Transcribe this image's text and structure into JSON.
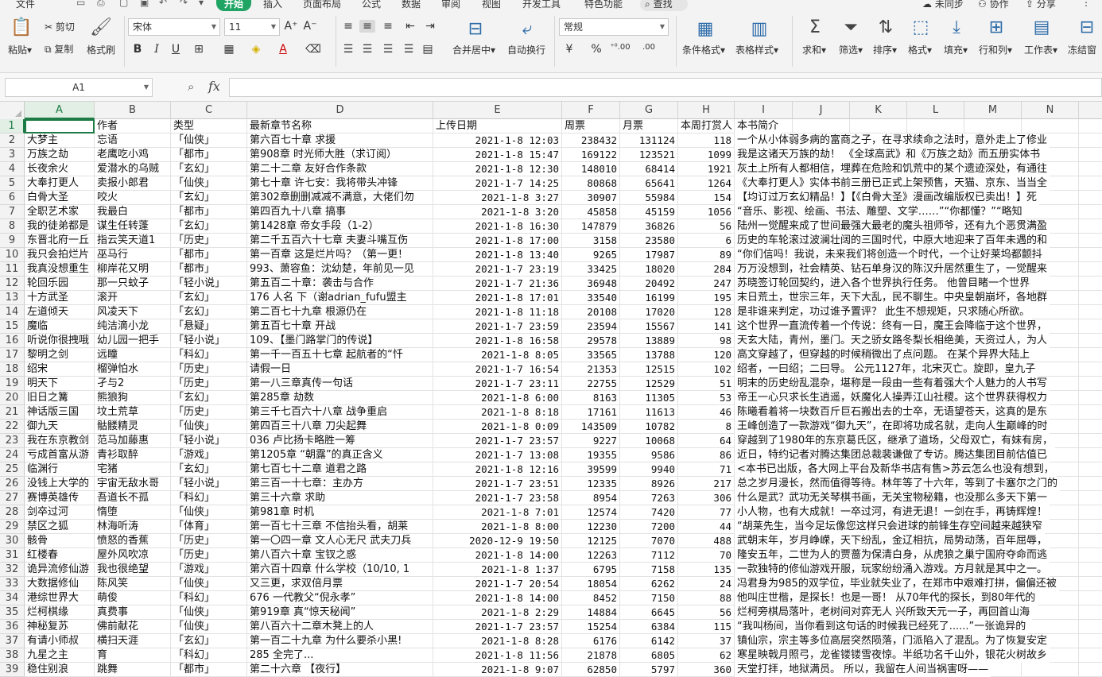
{
  "menubar": {
    "file": "文件",
    "tabs": [
      "开始",
      "插入",
      "页面布局",
      "公式",
      "数据",
      "审阅",
      "视图",
      "开发工具",
      "特色功能"
    ],
    "search": "查找",
    "right": [
      "未同步",
      "协作",
      "分享"
    ]
  },
  "ribbon": {
    "paste": "粘贴",
    "cut": "剪切",
    "copy": "复制",
    "format_painter": "格式刷",
    "font_name": "宋体",
    "font_size": "11",
    "merge_center": "合并居中",
    "wrap_text": "自动换行",
    "number_format": "常规",
    "currency": "¥",
    "percent": "%",
    "inc_decimal": "⁺⁰.00",
    "dec_decimal": ".00",
    "cond_format": "条件格式",
    "table_style": "表格样式",
    "sum": "求和",
    "filter": "筛选",
    "sort": "排序",
    "format": "格式",
    "fill": "填充",
    "row_col": "行和列",
    "worksheet": "工作表",
    "freeze": "冻结窗"
  },
  "formula": {
    "name_box": "A1",
    "value": ""
  },
  "grid": {
    "columns": [
      "A",
      "B",
      "C",
      "D",
      "E",
      "F",
      "G",
      "H",
      "I",
      "J",
      "K",
      "L",
      "M",
      "N"
    ],
    "rows": [
      [
        "",
        "作者",
        "类型",
        "最新章节名称",
        "上传日期",
        "周票",
        "月票",
        "本周打赏人",
        "本书简介"
      ],
      [
        "大梦主",
        "忘语",
        "「仙侠」",
        "第六百七十章 求援",
        "2021-1-8 12:03",
        "238432",
        "131124",
        "118",
        "一个从小体弱多病的富商之子，在寻求续命之法时，意外走上了修业"
      ],
      [
        "万族之劫",
        "老鹰吃小鸡",
        "「都市」",
        "第908章 时光师大胜（求订阅）",
        "2021-1-8 15:47",
        "169122",
        "123521",
        "1099",
        "我是这诸天万族的劫！  《全球高武》和《万族之劫》而五册实体书"
      ],
      [
        "长夜余火",
        "爱潜水的乌贼",
        "「玄幻」",
        "第二十二章 友好合作条款",
        "2021-1-8 12:30",
        "148010",
        "68414",
        "1921",
        "灰土上所有人都相信，埋葬在危险和饥荒中的某个遗迹深处，有通往"
      ],
      [
        "大奉打更人",
        "卖报小郎君",
        "「仙侠」",
        "第七十章 许七安：我将带头冲锋",
        "2021-1-7 14:25",
        "80868",
        "65641",
        "1264",
        "《大奉打更人》实体书前三册已正式上架预售，天猫、京东、当当全"
      ],
      [
        "白骨大圣",
        "咬火",
        "「玄幻」",
        "第302章删删减减不满意，大佬们勿",
        "2021-1-8 3:27",
        "30907",
        "55984",
        "154",
        "【均订过万玄幻精品！】【《白骨大圣》漫画改编版权已卖出！】死"
      ],
      [
        "全职艺术家",
        "我最白",
        "「都市」",
        "第四百九十八章 搞事",
        "2021-1-8 3:20",
        "45858",
        "45159",
        "1056",
        "“音乐、影视、绘画、书法、雕塑、文学……”“你都懂？”“略知"
      ],
      [
        "我的徒弟都是",
        "谋生任转蓬",
        "「玄幻」",
        "第1428章 帝女手段（1-2）",
        "2021-1-8 16:30",
        "147879",
        "36826",
        "56",
        "陆州一觉醒来成了世间最强大最老的魔头祖师爷，还有九个恶贯满盈"
      ],
      [
        "东晋北府一丘",
        "指云笑天道1",
        "「历史」",
        "第二千五百六十七章 夫妻斗嘴互伤",
        "2021-1-8 17:00",
        "3158",
        "23580",
        "6",
        "历史的车轮滚过波澜壮阔的三国时代，中原大地迎来了百年未遇的和"
      ],
      [
        "我只会拍烂片",
        "巫马行",
        "「都市」",
        "第一百章 这是烂片吗？（第一更！",
        "2021-1-8 13:40",
        "9265",
        "17987",
        "89",
        "“你们信吗！我说，未来我们将创造一个时代，一个让好莱坞都颤抖"
      ],
      [
        "我真没想重生",
        "柳岸花又明",
        "「都市」",
        "993、萧容鱼：沈幼楚，年前见一见",
        "2021-1-7 23:19",
        "33425",
        "18020",
        "284",
        "万万没想到，社会精英、钻石单身汉的陈汉升居然重生了，一觉醒来"
      ],
      [
        "轮回乐园",
        "那一只蚊子",
        "「轻小说」",
        "第五百二十章：袭击与合作",
        "2021-1-7 21:36",
        "36948",
        "20492",
        "247",
        "苏晓签订轮回契约，进入各个世界执行任务。  他曾目睹一个世界"
      ],
      [
        "十方武圣",
        "滚开",
        "「玄幻」",
        "176 人名 下（谢adrian_fufu盟主",
        "2021-1-8 17:01",
        "33540",
        "16199",
        "195",
        "末日荒土，世宗三年，天下大乱，民不聊生。中央皇朝崩坏，各地群"
      ],
      [
        "左道倾天",
        "风凌天下",
        "「玄幻」",
        "第二百七十九章 根源仍在",
        "2021-1-8 11:18",
        "20108",
        "17020",
        "128",
        "是非谁来判定，功过谁予置评？  此生不想规矩，只求随心所欲。"
      ],
      [
        "魔临",
        "纯洁滴小龙",
        "「悬疑」",
        "第五百七十章 开战",
        "2021-1-7 23:59",
        "23594",
        "15567",
        "141",
        "这个世界一直流传着一个传说：终有一日，魔王会降临于这个世界，"
      ],
      [
        "听说你很拽哦",
        "幼儿园一把手",
        "「轻小说」",
        "109、【墨门路掌门的传说】",
        "2021-1-8 16:58",
        "29578",
        "13889",
        "98",
        "天玄大陆，青州，墨门。天之骄女路冬梨长相绝美，天资过人，为人"
      ],
      [
        "黎明之剑",
        "远瞳",
        "「科幻」",
        "第一千一百五十七章 起航者的“忏",
        "2021-1-8 8:05",
        "33565",
        "13788",
        "120",
        "高文穿越了，但穿越的时候稍微出了点问题。  在某个异界大陆上"
      ],
      [
        "绍宋",
        "榴弹怕水",
        "「历史」",
        "请假一日",
        "2021-1-7 16:54",
        "21353",
        "12515",
        "102",
        "绍者，一曰绍；二曰导。  公元1127年，北宋灭亡。旋即，皇九子"
      ],
      [
        "明天下",
        "孑与2",
        "「历史」",
        "第一八三章真传一句话",
        "2021-1-7 23:11",
        "22755",
        "12529",
        "51",
        "明末的历史纷乱混杂，堪称是一段由一些有着强大个人魅力的人书写"
      ],
      [
        "旧日之篝",
        "熊狼狗",
        "「玄幻」",
        "第285章 劫数",
        "2021-1-8 6:00",
        "8163",
        "11305",
        "53",
        "帝王一心只求长生逍遥，妖魔化人操弄江山社稷。这个世界获得权力"
      ],
      [
        "神话版三国",
        "坟土荒草",
        "「历史」",
        "第三千七百六十八章 战争重启",
        "2021-1-8 8:18",
        "17161",
        "11613",
        "46",
        "陈曦看着将一块数百斤巨石搬出去的士卒，无语望苍天，这真的是东"
      ],
      [
        "御九天",
        "骷髅精灵",
        "「仙侠」",
        "第四百三十八章 刀尖起舞",
        "2021-1-8 0:09",
        "143509",
        "10782",
        "8",
        "王峰创造了一款游戏“御九天”，在即将功成名就，走向人生巅峰的时"
      ],
      [
        "我在东京教剑",
        "范马加藤惠",
        "「轻小说」",
        "036 卢比扬卡略胜一筹",
        "2021-1-7 23:57",
        "9227",
        "10068",
        "64",
        "穿越到了1980年的东京葛氏区，继承了道场，父母双亡，有妹有房，"
      ],
      [
        "亏成首富从游",
        "青衫取醉",
        "「游戏」",
        "第1205章 “朝露”的真正含义",
        "2021-1-7 13:08",
        "19355",
        "9586",
        "86",
        "近日，特约记者对腾达集团总裁裴谦做了专访。腾达集团目前估值已"
      ],
      [
        "临渊行",
        "宅猪",
        "「玄幻」",
        "第七百七十二章 道君之路",
        "2021-1-8 12:16",
        "39599",
        "9940",
        "71",
        "<本书已出版，各大网上平台及新华书店有售>苏云怎么也没有想到，"
      ],
      [
        "没钱上大学的",
        "宇宙无敌水哥",
        "「轻小说」",
        "第三百一十七章：主办方",
        "2021-1-7 23:51",
        "12335",
        "8926",
        "217",
        "总之岁月漫长，然而值得等待。林年等了十六年，等到了卡塞尔之门的"
      ],
      [
        "赛博英雄传",
        "吾道长不孤",
        "「科幻」",
        "第三十六章 求助",
        "2021-1-7 23:58",
        "8954",
        "7263",
        "306",
        "什么是武？武功无关琴棋书画，无关宝物秘籍，也没那么多天下第一"
      ],
      [
        "剑卒过河",
        "惰堕",
        "「仙侠」",
        "第981章 时机",
        "2021-1-8 7:01",
        "12574",
        "7420",
        "77",
        "小人物，也有大成就！一卒过河，有进无退！一剑在手，再铸辉煌！"
      ],
      [
        "禁区之狐",
        "林海听涛",
        "「体育」",
        "第一百七十三章 不信抬头看，胡莱",
        "2021-1-8 8:00",
        "12230",
        "7200",
        "44",
        "“胡莱先生，当今足坛像您这样只会进球的前锋生存空间越来越狭窄"
      ],
      [
        "骸骨",
        "愤怒的香蕉",
        "「历史」",
        "第一〇四一章 文人心无尺 武夫刀兵",
        "2020-12-9 19:50",
        "12125",
        "7070",
        "488",
        "武朝末年，岁月峥嵘，天下纷乱，金辽相抗，局势动荡，百年屈辱，"
      ],
      [
        "红楼春",
        "屋外风吹凉",
        "「历史」",
        "第八百六十章 宝钗之惑",
        "2021-1-8 14:00",
        "12263",
        "7112",
        "70",
        "隆安五年，二世为人的贾蔷为保清白身，从虎狼之巢宁国府夺命而逃"
      ],
      [
        "诡异流修仙游",
        "我也很绝望",
        "「游戏」",
        "第六百十四章 什么学校（10/10, 1",
        "2021-1-8 1:37",
        "6795",
        "7158",
        "135",
        "一款独特的修仙游戏开服，玩家纷纷涌入游戏。方月就是其中之一。"
      ],
      [
        "大数据修仙",
        "陈风笑",
        "「仙侠」",
        "又三更，求双倍月票",
        "2021-1-7 20:54",
        "18054",
        "6262",
        "24",
        "冯君身为985的双学位，毕业就失业了，在郑市中艰难打拼，偏偏还被"
      ],
      [
        "港综世界大",
        "萌俊",
        "「科幻」",
        "676 一代教父“倪永孝”",
        "2021-1-8 14:00",
        "8452",
        "7150",
        "88",
        "他叫庄世楷，是探长！也是一哥！  从70年代的探长，到80年代的"
      ],
      [
        "烂柯棋缘",
        "真费事",
        "「仙侠」",
        "第919章 真“惊天秘闻”",
        "2021-1-8 2:29",
        "14884",
        "6645",
        "56",
        "烂柯旁棋局落叶，老树间对弈无人  兴所致天元一子，再回首山海"
      ],
      [
        "神秘复苏",
        "佛前献花",
        "「仙侠」",
        "第八百六十二章木凳上的人",
        "2021-1-7 23:57",
        "15254",
        "6384",
        "115",
        "“我叫杨间，当你看到这句话的时候我已经死了......”一张诡异的"
      ],
      [
        "有请小师叔",
        "横扫天涯",
        "「玄幻」",
        "第一百二十九章 为什么要杀小黑!",
        "2021-1-8 8:28",
        "6176",
        "6142",
        "37",
        "镇仙宗，宗主等多位高层突然陨落，门派陷入了混乱。为了恢复安定"
      ],
      [
        "九星之主",
        "育",
        "「科幻」",
        "285 全完了...",
        "2021-1-8 11:56",
        "21878",
        "6805",
        "62",
        "寒星映戟月照弓，龙雀镂镂雪夜惊。半纸功名千山外，银花火树故乡"
      ],
      [
        "稳住别浪",
        "跳舞",
        "「都市」",
        "第二十六章 【夜行】",
        "2021-1-8 9:07",
        "62850",
        "5797",
        "360",
        "天堂打拝，地狱满员。  所以，我留在人间当祸害呀——"
      ]
    ]
  }
}
